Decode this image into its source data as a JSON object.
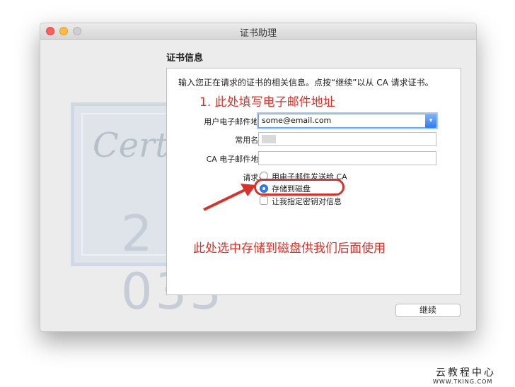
{
  "window": {
    "title": "证书助理"
  },
  "section_title": "证书信息",
  "description": "输入您正在请求的证书的相关信息。点按“继续”以从 CA 请求证书。",
  "annotations": {
    "step1": "1. 此处填写电子邮件地址",
    "step2": "此处选中存储到磁盘供我们后面使用",
    "colors": {
      "annotation_red": "#d9322a"
    }
  },
  "form": {
    "user_email_label": "用户电子邮件地址:",
    "user_email_value": "some@email.com",
    "common_name_label": "常用名称:",
    "common_name_value": "",
    "ca_email_label": "CA 电子邮件地址:",
    "ca_email_value": "",
    "request_label": "请求是:",
    "options": [
      {
        "label": "用电子邮件发送给 CA",
        "selected": false
      },
      {
        "label": "存储到磁盘",
        "selected": true
      }
    ],
    "specify_key_label": "让我指定密钥对信息",
    "specify_key_checked": false
  },
  "buttons": {
    "continue": "继续"
  },
  "watermark": {
    "cn": "云教程中心",
    "en": "WWW.TKING.COM"
  }
}
